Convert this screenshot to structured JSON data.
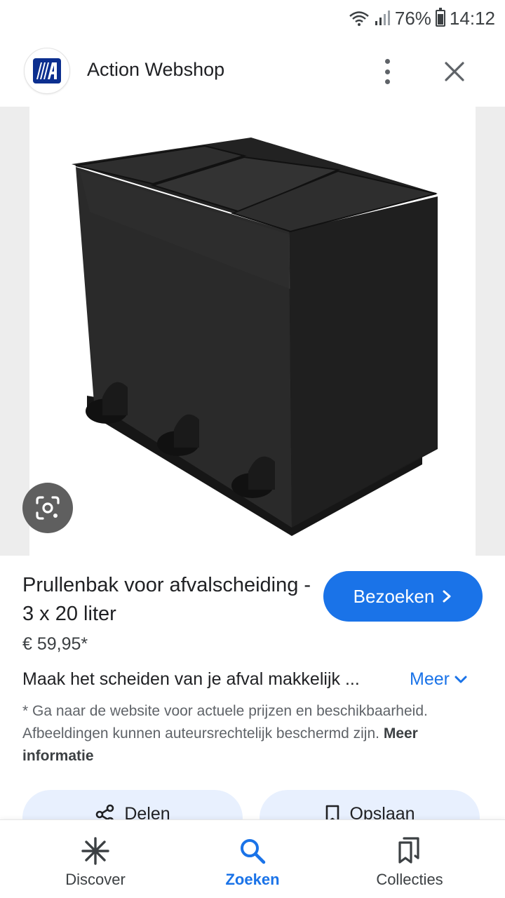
{
  "status_bar": {
    "battery": "76%",
    "time": "14:12",
    "icons": [
      "wifi-icon",
      "signal-icon",
      "battery-icon"
    ]
  },
  "header": {
    "site_name": "Action Webshop",
    "icons": [
      "site-logo",
      "more-vert-icon",
      "close-icon"
    ]
  },
  "product": {
    "title": "Prullenbak voor afvalscheiding - 3 x 20 liter",
    "price": "€ 59,95*",
    "description": "Maak het scheiden van je afval makkelijk ...",
    "more_label": "Meer",
    "visit_label": "Bezoeken",
    "disclaimer": "* Ga naar de website voor actuele prijzen en beschikbaarheid. Afbeeldingen kunnen auteursrechtelijk beschermd zijn.",
    "disclaimer_link": "Meer informatie"
  },
  "actions": {
    "share_label": "Delen",
    "save_label": "Opslaan"
  },
  "nav": {
    "discover": "Discover",
    "search": "Zoeken",
    "collections": "Collecties",
    "active": "search"
  },
  "colors": {
    "accent": "#1a73e8",
    "action_bg": "#e8f0fe",
    "logo": "#0c2f8f"
  }
}
